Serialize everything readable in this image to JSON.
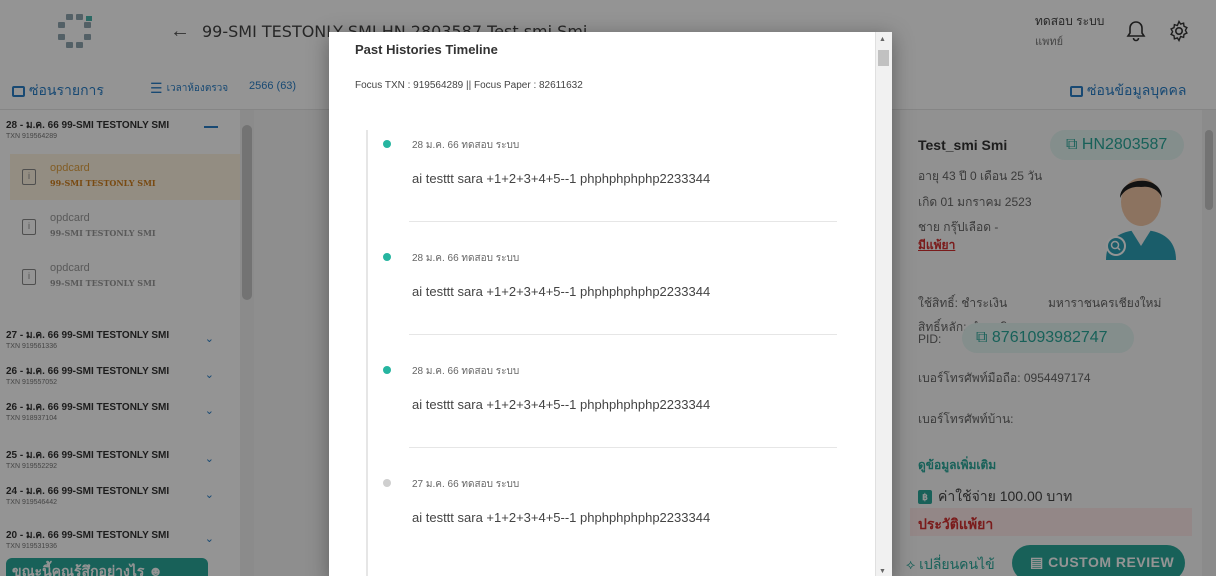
{
  "header": {
    "back_glyph": "←",
    "patient_title": "99-SMI TESTONLY SMI    HN 2803587 Test  smi Smi",
    "user_name": "ทดสอบ ระบบ",
    "user_role": "แพทย์"
  },
  "toolbar": {
    "hide_list_label": "ซ่อนรายการ",
    "filter_label": "เวลาห้องตรวจ",
    "year_label": "2566 (63)",
    "hide_person_label": "ซ่อนข้อมูลบุคคล"
  },
  "sidebar": {
    "groups": [
      {
        "title": "28 - ม.ค. 66 99-SMI TESTONLY SMI",
        "txn": "TXN 919564289",
        "expanded": true
      },
      {
        "title": "27 - ม.ค. 66 99-SMI TESTONLY SMI",
        "txn": "TXN 919561336"
      },
      {
        "title": "26 - ม.ค. 66 99-SMI TESTONLY SMI",
        "txn": "TXN 919557052"
      },
      {
        "title": "26 - ม.ค. 66 99-SMI TESTONLY SMI",
        "txn": "TXN 918937104"
      },
      {
        "title": "25 - ม.ค. 66 99-SMI TESTONLY SMI",
        "txn": "TXN 919552292"
      },
      {
        "title": "24 - ม.ค. 66 99-SMI TESTONLY SMI",
        "txn": "TXN 919546442"
      },
      {
        "title": "20 - ม.ค. 66 99-SMI TESTONLY SMI",
        "txn": "TXN 919531936"
      }
    ],
    "sub_items": [
      {
        "title": "opdcard",
        "desc": "99-SMI TESTONLY SMI"
      },
      {
        "title": "opdcard",
        "desc": "99-SMI TESTONLY SMI"
      },
      {
        "title": "opdcard",
        "desc": "99-SMI TESTONLY SMI"
      }
    ],
    "chat_banner": "ขณะนี้คุณรู้สึกอย่างไร ☻"
  },
  "patient": {
    "name": "Test_smi Smi",
    "hn": "HN2803587",
    "age": "อายุ 43 ปี 0 เดือน 25 วัน",
    "birth": "เกิด 01 มกราคม 2523",
    "sex_blood": "ชาย กรุ๊ปเลือด -",
    "allergy_flag": "มีแพ้ยา",
    "rights": "ใช้สิทธิ์: ชำระเงิน",
    "hospital": "มหาราชนครเชียงใหม่",
    "main_rights": "สิทธิ์หลัก: ชำระเงิน",
    "pid_label": "PID:",
    "pid": "8761093982747",
    "mobile": "เบอร์โทรศัพท์มือถือ: 0954497174",
    "home_phone": "เบอร์โทรศัพท์บ้าน:",
    "more_info": "ดูข้อมูลเพิ่มเติม",
    "cost_badge": "฿",
    "cost": "ค่าใช้จ่าย 100.00 บาท",
    "allergy_history": "ประวัติแพ้ยา",
    "change_patient": "⟡ เปลี่ยนคนไข้",
    "custom_review": "CUSTOM REVIEW"
  },
  "modal": {
    "title": "Past Histories Timeline",
    "focus": "Focus TXN : 919564289 || Focus Paper : 82611632",
    "entries": [
      {
        "meta": "28 ม.ค. 66 ทดสอบ ระบบ",
        "text": "ai testtt sara +1+2+3+4+5--1 phphphphphp2233344",
        "dot": "teal"
      },
      {
        "meta": "28 ม.ค. 66 ทดสอบ ระบบ",
        "text": "ai testtt sara +1+2+3+4+5--1 phphphphphp2233344",
        "dot": "teal"
      },
      {
        "meta": "28 ม.ค. 66 ทดสอบ ระบบ",
        "text": "ai testtt sara +1+2+3+4+5--1 phphphphphp2233344",
        "dot": "teal"
      },
      {
        "meta": "27 ม.ค. 66 ทดสอบ ระบบ",
        "text": "ai testtt sara +1+2+3+4+5--1 phphphphphp2233344",
        "dot": "grey"
      }
    ]
  },
  "colors": {
    "accent": "#2aa89a",
    "link": "#2a7fc7",
    "danger": "#d32f2f"
  }
}
